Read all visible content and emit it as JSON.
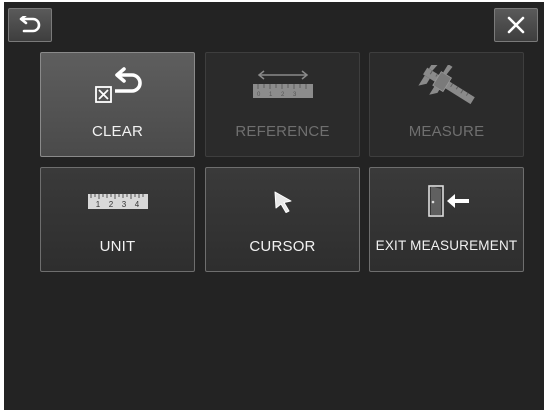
{
  "topbar": {
    "back_icon": "back-arrow-icon",
    "close_icon": "close-x-icon"
  },
  "menu": {
    "clear": {
      "label": "CLEAR",
      "icon": "clear-icon",
      "state": "selected"
    },
    "reference": {
      "label": "REFERENCE",
      "icon": "ruler-reference-icon",
      "state": "disabled"
    },
    "measure": {
      "label": "MEASURE",
      "icon": "caliper-icon",
      "state": "disabled"
    },
    "unit": {
      "label": "UNIT",
      "icon": "ruler-unit-icon",
      "ruler_digits": [
        "1",
        "2",
        "3",
        "4"
      ]
    },
    "cursor": {
      "label": "CURSOR",
      "icon": "cursor-arrow-icon"
    },
    "exit": {
      "label": "EXIT MEASUREMENT",
      "icon": "exit-door-icon"
    }
  },
  "colors": {
    "background": "#232323",
    "tile": "#333333",
    "tile_selected": "#555555",
    "label": "#f2f2f2",
    "label_disabled": "#6f6f6f"
  }
}
